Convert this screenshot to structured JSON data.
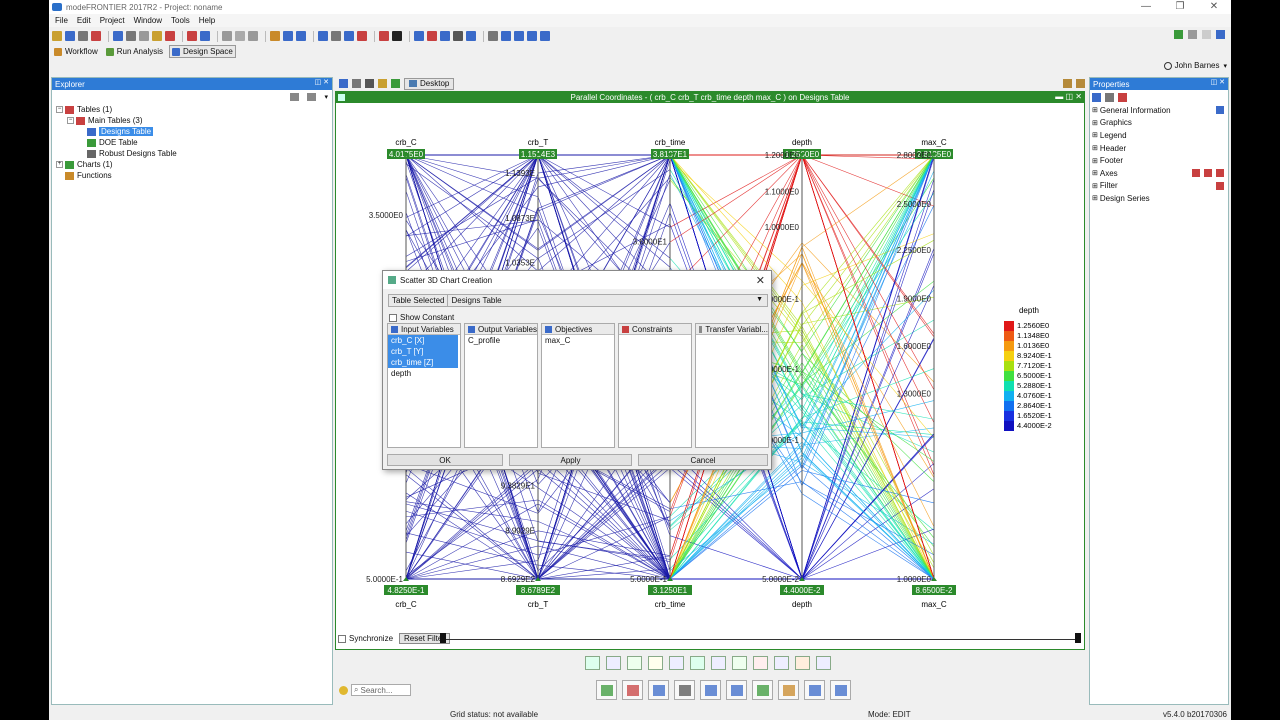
{
  "app": {
    "title": "modeFRONTIER 2017R2 - Project: noname",
    "window_buttons": [
      "—",
      "❐",
      "✕"
    ]
  },
  "menu": [
    "File",
    "Edit",
    "Project",
    "Window",
    "Tools",
    "Help"
  ],
  "toolbar2": [
    {
      "label": "Workflow",
      "color": "#c98a2a"
    },
    {
      "label": "Run Analysis",
      "color": "#5a9a3a"
    },
    {
      "label": "Design Space",
      "color": "#3a6ac9"
    }
  ],
  "user": {
    "name": "John Barnes"
  },
  "explorer": {
    "title": "Explorer",
    "tree": [
      {
        "label": "Tables (1)",
        "level": 0,
        "expander": "−",
        "icon_color": "#c84040"
      },
      {
        "label": "Main Tables (3)",
        "level": 1,
        "expander": "−",
        "icon_color": "#c84040"
      },
      {
        "label": "Designs Table",
        "level": 2,
        "icon_color": "#3a6ac9",
        "selected": true
      },
      {
        "label": "DOE Table",
        "level": 2,
        "icon_color": "#3a9a3a"
      },
      {
        "label": "Robust Designs Table",
        "level": 2,
        "icon_color": "#666666"
      },
      {
        "label": "Charts (1)",
        "level": 0,
        "expander": "+",
        "icon_color": "#3a9a3a"
      },
      {
        "label": "Functions",
        "level": 0,
        "icon_color": "#c98a2a"
      }
    ]
  },
  "desktop": {
    "tab": "Desktop"
  },
  "chart_window": {
    "title": "Parallel Coordinates - ( crb_C  crb_T  crb_time  depth  max_C ) on Designs Table",
    "synchronize": "Synchronize",
    "reset_filter": "Reset Filter"
  },
  "chart_data": {
    "type": "parallel-coordinates",
    "axes": [
      {
        "name": "crb_C",
        "top_value": "4.0175E0",
        "bottom_value": "4.8250E-1",
        "ticks": [
          {
            "label": "3.5000E0",
            "t": 0.141
          },
          {
            "label": "2.50",
            "t": 0.434
          },
          {
            "label": "1.50",
            "t": 0.717
          },
          {
            "label": "5.0000E-1",
            "t": 1.0
          }
        ]
      },
      {
        "name": "crb_T",
        "top_value": "1.1514E3",
        "bottom_value": "8.6789E2",
        "ticks": [
          {
            "label": "1.1393E",
            "t": 0.042
          },
          {
            "label": "1.0873E",
            "t": 0.149
          },
          {
            "label": "1.0353E",
            "t": 0.254
          },
          {
            "label": "9.3829E1",
            "t": 0.78
          },
          {
            "label": "8.9929E",
            "t": 0.886
          },
          {
            "label": "8.6929E2",
            "t": 1.0
          }
        ]
      },
      {
        "name": "crb_time",
        "top_value": "3.8187E1",
        "bottom_value": "3.1250E1",
        "ticks": [
          {
            "label": "3.6000E1",
            "t": 0.204
          },
          {
            "label": "5.0000E-1",
            "t": 1.0
          }
        ]
      },
      {
        "name": "depth",
        "top_value": "1.2560E0",
        "bottom_value": "4.4000E-2",
        "ticks": [
          {
            "label": "1.2000E0",
            "t": 0.0
          },
          {
            "label": "1.1000E0",
            "t": 0.086
          },
          {
            "label": "1.0000E0",
            "t": 0.17
          },
          {
            "label": "8.0000E-1",
            "t": 0.34
          },
          {
            "label": "6.0000E-1",
            "t": 0.505
          },
          {
            "label": "4.0000E-1",
            "t": 0.672
          },
          {
            "label": "5.0000E-2",
            "t": 1.0
          }
        ]
      },
      {
        "name": "max_C",
        "top_value": "2.8135E0",
        "bottom_value": "8.6500E-2",
        "ticks": [
          {
            "label": "2.8000E0",
            "t": 0.0
          },
          {
            "label": "2.5000E0",
            "t": 0.116
          },
          {
            "label": "2.2500E0",
            "t": 0.224
          },
          {
            "label": "1.9000E0",
            "t": 0.338
          },
          {
            "label": "1.6000E0",
            "t": 0.45
          },
          {
            "label": "1.3000E0",
            "t": 0.563
          },
          {
            "label": "1.0000E0",
            "t": 1.0
          }
        ]
      }
    ],
    "color_by": "depth",
    "legend": {
      "title": "depth",
      "values": [
        "1.2560E0",
        "1.1348E0",
        "1.0136E0",
        "8.9240E-1",
        "7.7120E-1",
        "6.5000E-1",
        "5.2880E-1",
        "4.0760E-1",
        "2.8640E-1",
        "1.6520E-1",
        "4.4000E-2"
      ],
      "colors": [
        "#e01818",
        "#ee5a14",
        "#f59a10",
        "#f5d010",
        "#a8e010",
        "#40e040",
        "#10e0b0",
        "#10b0f0",
        "#1070f0",
        "#1830e0",
        "#1010c0"
      ]
    }
  },
  "dialog": {
    "title": "Scatter 3D Chart Creation",
    "close": "✕",
    "table_label": "Table Selected",
    "table_value": "Designs Table",
    "show_constant": "Show Constant",
    "columns": [
      {
        "header": "Input Variables",
        "icon_color": "#3a6ac9",
        "items": [
          "crb_C [X]",
          "crb_T [Y]",
          "crb_time [Z]",
          "depth"
        ],
        "selected": [
          0,
          1,
          2
        ]
      },
      {
        "header": "Output Variables",
        "icon_color": "#3a6ac9",
        "items": [
          "C_profile"
        ],
        "selected": []
      },
      {
        "header": "Objectives",
        "icon_color": "#3a6ac9",
        "items": [
          "max_C"
        ],
        "selected": []
      },
      {
        "header": "Constraints",
        "icon_color": "#c84040",
        "items": [],
        "selected": []
      },
      {
        "header": "Transfer Variabl...",
        "icon_color": "#888888",
        "items": [],
        "selected": []
      }
    ],
    "buttons": [
      "OK",
      "Apply",
      "Cancel"
    ]
  },
  "properties": {
    "title": "Properties",
    "items": [
      "General Information",
      "Graphics",
      "Legend",
      "Header",
      "Footer",
      "Axes",
      "Filter",
      "Design Series"
    ]
  },
  "search": {
    "placeholder": "Search..."
  },
  "status": {
    "grid": "Grid status: not available",
    "mode": "Mode: EDIT",
    "version": "v5.4.0 b20170306"
  }
}
